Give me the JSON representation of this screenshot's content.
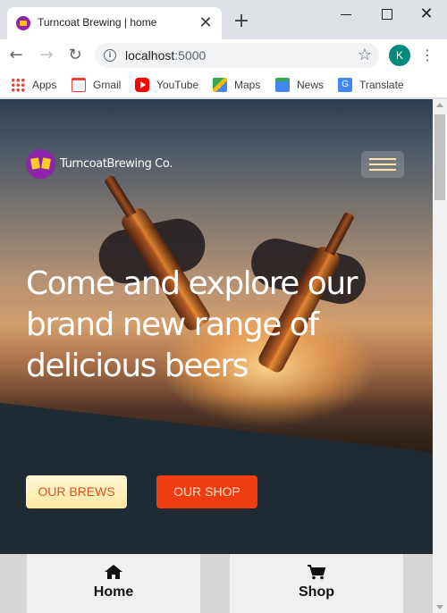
{
  "browser": {
    "tab": {
      "title": "Turncoat Brewing | home",
      "close_glyph": "✕"
    },
    "new_tab_glyph": "+",
    "window_controls": {
      "close_glyph": "✕"
    },
    "nav": {
      "back": "←",
      "forward": "→",
      "reload": "↻"
    },
    "address": {
      "host": "localhost",
      "port": ":5000",
      "info_glyph": "i",
      "star_glyph": "☆"
    },
    "profile_initial": "K",
    "menu_glyph": "⋮",
    "bookmarks": [
      {
        "label": "Apps",
        "icon": "apps-grid-icon"
      },
      {
        "label": "Gmail",
        "icon": "gmail-icon"
      },
      {
        "label": "YouTube",
        "icon": "youtube-icon"
      },
      {
        "label": "Maps",
        "icon": "maps-icon"
      },
      {
        "label": "News",
        "icon": "news-icon"
      },
      {
        "label": "Translate",
        "icon": "translate-icon"
      }
    ]
  },
  "site": {
    "brand": {
      "name": "TurncoatBrewing Co."
    },
    "hero": {
      "title": "Come and explore our brand new range of delicious beers"
    },
    "buttons": {
      "brews": "OUR BREWS",
      "shop": "OUR SHOP"
    },
    "bottom_nav": [
      {
        "label": "Home",
        "icon": "home-icon",
        "glyph": "⌂"
      },
      {
        "label": "Shop",
        "icon": "cart-icon",
        "glyph": "🛒"
      }
    ],
    "colors": {
      "brand_purple": "#8e24aa",
      "shop_button": "#f03c12",
      "brews_button": "#ffe7a0",
      "dark_band": "#1f2a33"
    }
  }
}
